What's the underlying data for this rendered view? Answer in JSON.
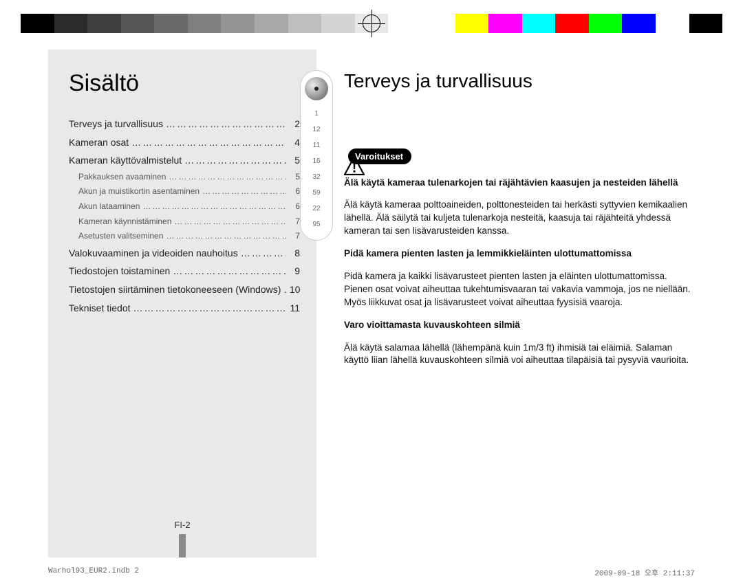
{
  "color_bars": [
    "#000000",
    "#2b2b2b",
    "#404040",
    "#555555",
    "#6a6a6a",
    "#7f7f7f",
    "#949494",
    "#a9a9a9",
    "#bebebe",
    "#d3d3d3",
    "#e8e8e8",
    "#ffffff",
    "#ffffff",
    "#ffff00",
    "#ff00ff",
    "#00ffff",
    "#ff0000",
    "#00ff00",
    "#0000ff",
    "#ffffff",
    "#000000"
  ],
  "left": {
    "heading": "Sisältö",
    "toc_main": [
      {
        "label": "Terveys ja turvallisuus",
        "page": "2"
      },
      {
        "label": "Kameran osat",
        "page": "4"
      },
      {
        "label": "Kameran käyttövalmistelut",
        "page": "5"
      }
    ],
    "toc_sub": [
      {
        "label": "Pakkauksen avaaminen",
        "page": "5"
      },
      {
        "label": "Akun ja muistikortin asentaminen",
        "page": "6"
      },
      {
        "label": "Akun lataaminen",
        "page": "6"
      },
      {
        "label": "Kameran käynnistäminen",
        "page": "7"
      },
      {
        "label": "Asetusten valitseminen",
        "page": "7"
      }
    ],
    "toc_main2": [
      {
        "label": "Valokuvaaminen ja videoiden nauhoitus",
        "page": "8"
      },
      {
        "label": "Tiedostojen toistaminen",
        "page": "9"
      },
      {
        "label": "Tietostojen siirtäminen tietokoneeseen (Windows)",
        "page": "10"
      },
      {
        "label": "Tekniset tiedot",
        "page": "11"
      }
    ],
    "thumb_numbers": [
      "1",
      "12",
      "11",
      "16",
      "32",
      "59",
      "22",
      "95"
    ],
    "page_number": "FI-2"
  },
  "right": {
    "heading": "Terveys ja turvallisuus",
    "pill_label": "Varoitukset",
    "sections": [
      {
        "bold": "Älä käytä kameraa tulenarkojen tai räjähtävien kaasujen ja nesteiden lähellä",
        "text": "Älä käytä kameraa polttoaineiden, polttonesteiden tai herkästi syttyvien kemikaalien lähellä. Älä säilytä tai kuljeta tulenarkoja nesteitä, kaasuja tai räjähteitä yhdessä kameran tai sen lisävarusteiden kanssa."
      },
      {
        "bold": "Pidä kamera pienten lasten ja lemmikkieläinten ulottumattomissa",
        "text": "Pidä kamera ja kaikki lisävarusteet pienten lasten ja eläinten ulottumattomissa. Pienen osat voivat aiheuttaa tukehtumisvaaran tai vakavia vammoja, jos ne niellään. Myös liikkuvat osat ja lisävarusteet voivat aiheuttaa fyysisiä vaaroja."
      },
      {
        "bold": "Varo vioittamasta kuvauskohteen silmiä",
        "text": "Älä käytä salamaa lähellä (lähempänä kuin 1m/3 ft) ihmisiä tai eläimiä. Salaman käyttö liian lähellä kuvauskohteen silmiä voi aiheuttaa tilapäisiä tai pysyviä vaurioita."
      }
    ]
  },
  "footer": {
    "left": "Warhol93_EUR2.indb   2",
    "right": "2009-09-18   오후 2:11:37"
  }
}
